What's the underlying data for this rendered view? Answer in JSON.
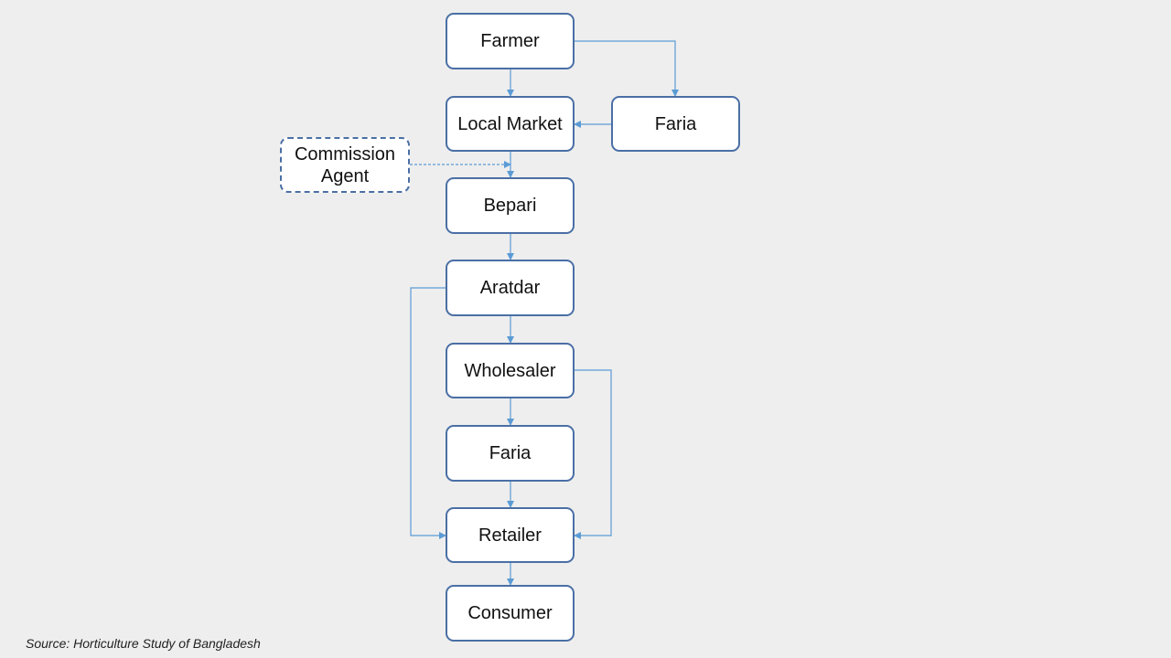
{
  "nodes": {
    "farmer": "Farmer",
    "local_market": "Local Market",
    "faria_top": "Faria",
    "commission_agent": "Commission Agent",
    "bepari": "Bepari",
    "aratdar": "Aratdar",
    "wholesaler": "Wholesaler",
    "faria": "Faria",
    "retailer": "Retailer",
    "consumer": "Consumer"
  },
  "edges": [
    [
      "farmer",
      "local_market"
    ],
    [
      "farmer",
      "faria_top"
    ],
    [
      "faria_top",
      "local_market"
    ],
    [
      "local_market",
      "bepari"
    ],
    [
      "commission_agent",
      "bepari",
      "dashed"
    ],
    [
      "bepari",
      "aratdar"
    ],
    [
      "aratdar",
      "wholesaler"
    ],
    [
      "aratdar",
      "retailer"
    ],
    [
      "wholesaler",
      "faria"
    ],
    [
      "wholesaler",
      "retailer"
    ],
    [
      "faria",
      "retailer"
    ],
    [
      "retailer",
      "consumer"
    ]
  ],
  "colors": {
    "box_border": "#4a6fa5",
    "connector": "#5b9bd5",
    "background": "#eeeeee"
  },
  "source": "Source: Horticulture Study of Bangladesh"
}
